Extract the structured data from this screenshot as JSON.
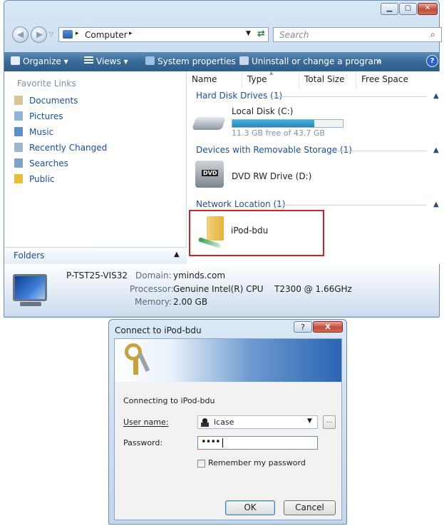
{
  "explorer": {
    "address": {
      "root_label": "Computer"
    },
    "search": {
      "placeholder": "Search"
    },
    "toolbar": {
      "organize": "Organize",
      "views": "Views",
      "system_properties": "System properties",
      "uninstall": "Uninstall or change a program",
      "more": "»",
      "help": "?"
    },
    "nav": {
      "heading": "Favorite Links",
      "items": [
        "Documents",
        "Pictures",
        "Music",
        "Recently Changed",
        "Searches",
        "Public"
      ],
      "folders_label": "Folders"
    },
    "columns": [
      "Name",
      "Type",
      "Total Size",
      "Free Space"
    ],
    "groups": [
      {
        "title": "Hard Disk Drives (1)"
      },
      {
        "title": "Devices with Removable Storage (1)"
      },
      {
        "title": "Network Location (1)"
      }
    ],
    "local_disk": {
      "name": "Local Disk (C:)",
      "free_text": "11.3 GB free of 43.7 GB",
      "used_fraction": 0.74
    },
    "dvd": {
      "name": "DVD RW Drive (D:)",
      "badge": "DVD"
    },
    "network": {
      "name": "iPod-bdu"
    },
    "details": {
      "computer_name": "P-TST25-VIS32",
      "domain_label": "Domain:",
      "domain_value": "yminds.com",
      "processor_label": "Processor:",
      "processor_value": "Genuine Intel(R) CPU",
      "processor_model": "T2300  @ 1.66GHz",
      "memory_label": "Memory:",
      "memory_value": "2.00 GB"
    },
    "colors": {
      "highlight_box": "#c8262b",
      "toolbar": "#3a6a98",
      "link": "#1b4ea0"
    }
  },
  "dialog": {
    "title": "Connect to iPod-bdu",
    "help_btn": "?",
    "close_btn": "X",
    "connecting_text": "Connecting to iPod-bdu",
    "username_label": "User name:",
    "username_value": "icase",
    "browse_btn": "...",
    "password_label": "Password:",
    "password_value": "••••",
    "remember_label": "Remember my password",
    "ok": "OK",
    "cancel": "Cancel"
  }
}
